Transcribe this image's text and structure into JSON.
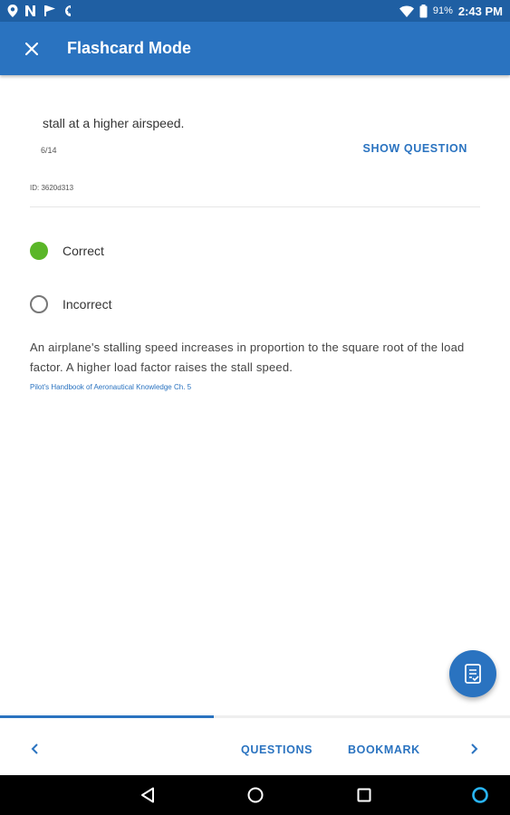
{
  "status_bar": {
    "left_icons": [
      "location-pin-icon",
      "n-notification-icon",
      "flag-notification-icon",
      "quick-charge-icon"
    ],
    "battery_percent": "91%",
    "time": "2:43 PM"
  },
  "app_bar": {
    "title": "Flashcard Mode",
    "close_icon": "close-icon"
  },
  "card": {
    "question_text": "stall at a higher airspeed.",
    "counter": "6/14",
    "show_question_label": "SHOW QUESTION",
    "id_label": "ID: 3620d313"
  },
  "options": [
    {
      "label": "Correct",
      "selected": true
    },
    {
      "label": "Incorrect",
      "selected": false
    }
  ],
  "explanation": "An airplane's stalling speed increases in proportion to the square root of the load factor.  A higher load factor raises the stall speed.",
  "reference": "Pilot's Handbook of Aeronautical Knowledge Ch. 5",
  "fab": {
    "icon": "checklist-icon"
  },
  "bottom_bar": {
    "progress_fraction": 0.42,
    "prev_icon": "chevron-left-icon",
    "questions_label": "QUESTIONS",
    "bookmark_label": "BOOKMARK",
    "next_icon": "chevron-right-icon"
  },
  "nav_bar": {
    "icons": [
      "back-icon",
      "home-icon",
      "recents-icon",
      "assistant-icon"
    ]
  },
  "colors": {
    "status_bar": "#1f5fa3",
    "primary": "#2a73c0",
    "correct_green": "#5ab628"
  }
}
